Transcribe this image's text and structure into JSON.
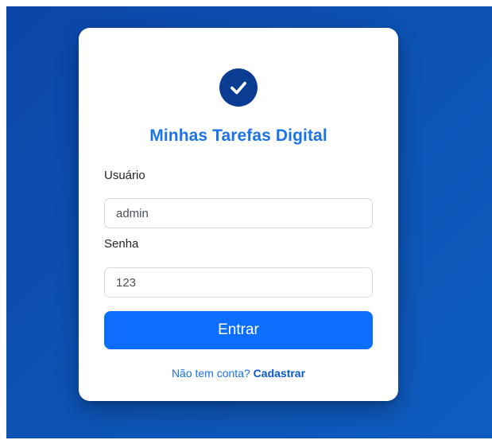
{
  "colors": {
    "background": "#0d54b6",
    "card": "#ffffff",
    "logo_circle": "#0a3d91",
    "title": "#1a73e8",
    "primary_button": "#0d6efd",
    "link": "#0a58ca"
  },
  "logo": {
    "icon": "check-icon"
  },
  "login": {
    "title": "Minhas Tarefas Digital",
    "username_label": "Usuário",
    "username_value": "admin",
    "password_label": "Senha",
    "password_value": "123",
    "submit_label": "Entrar",
    "signup_prompt": "Não tem conta? ",
    "signup_link": "Cadastrar"
  }
}
